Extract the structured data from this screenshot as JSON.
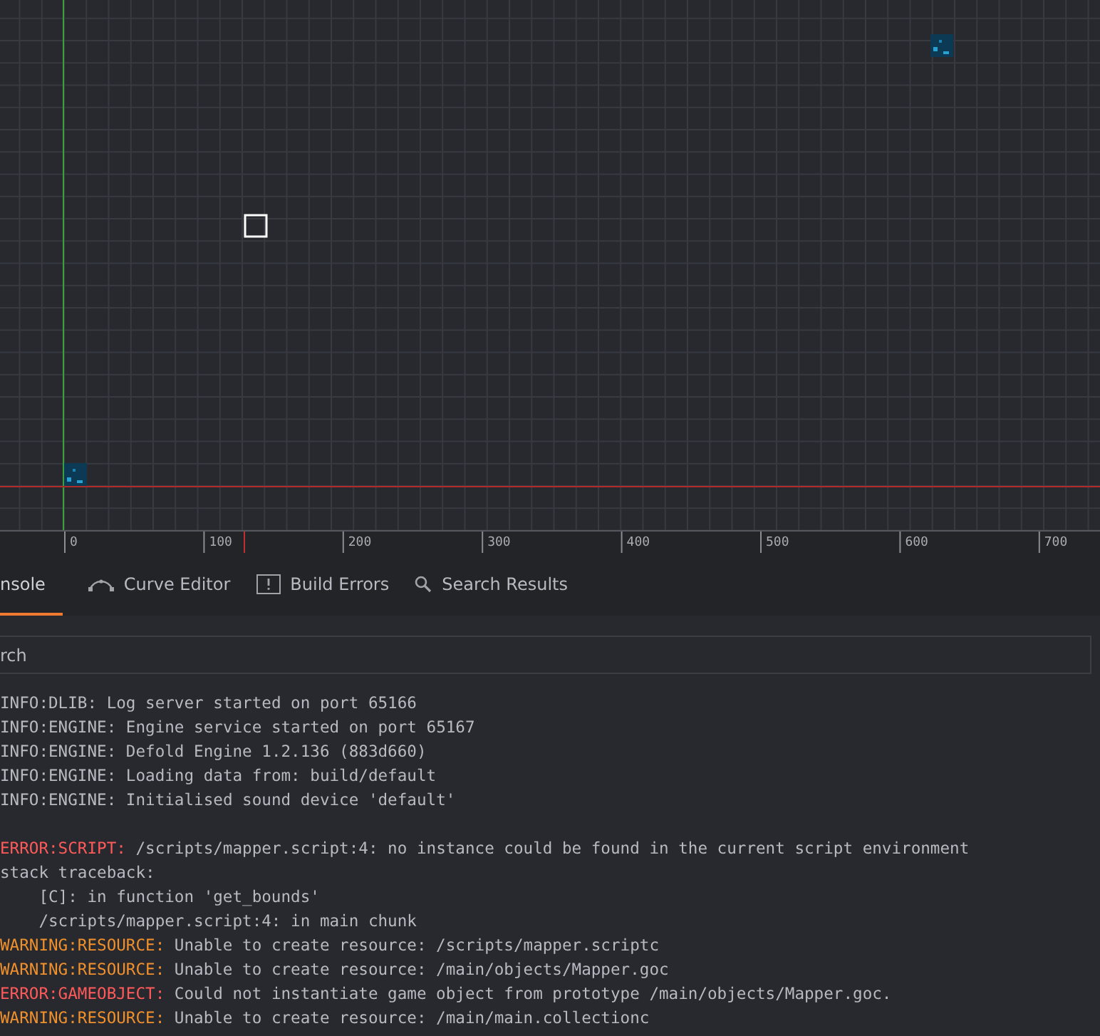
{
  "viewport": {
    "ruler": {
      "labels": [
        "0",
        "100",
        "200",
        "300",
        "400",
        "500",
        "600",
        "700"
      ]
    }
  },
  "tabs": [
    {
      "label": "nsole",
      "kind": "plain",
      "selected": true
    },
    {
      "label": "Curve Editor",
      "kind": "curve",
      "selected": false
    },
    {
      "label": "Build Errors",
      "kind": "errors",
      "selected": false
    },
    {
      "label": "Search Results",
      "kind": "search",
      "selected": false
    }
  ],
  "search": {
    "placeholder": "rch"
  },
  "console": [
    {
      "kind": "info",
      "prefix": "INFO:DLIB:",
      "text": " Log server started on port 65166"
    },
    {
      "kind": "info",
      "prefix": "INFO:ENGINE:",
      "text": " Engine service started on port 65167"
    },
    {
      "kind": "info",
      "prefix": "INFO:ENGINE:",
      "text": " Defold Engine 1.2.136 (883d660)"
    },
    {
      "kind": "info",
      "prefix": "INFO:ENGINE:",
      "text": " Loading data from: build/default"
    },
    {
      "kind": "info",
      "prefix": "INFO:ENGINE:",
      "text": " Initialised sound device 'default'"
    },
    {
      "kind": "blank"
    },
    {
      "kind": "error",
      "prefix": "ERROR:SCRIPT:",
      "text": " /scripts/mapper.script:4: no instance could be found in the current script environment"
    },
    {
      "kind": "plain",
      "text": "stack traceback:"
    },
    {
      "kind": "plain",
      "text": "    [C]: in function 'get_bounds'"
    },
    {
      "kind": "plain",
      "text": "    /scripts/mapper.script:4: in main chunk"
    },
    {
      "kind": "warning",
      "prefix": "WARNING:RESOURCE:",
      "text": " Unable to create resource: /scripts/mapper.scriptc"
    },
    {
      "kind": "warning",
      "prefix": "WARNING:RESOURCE:",
      "text": " Unable to create resource: /main/objects/Mapper.goc"
    },
    {
      "kind": "error",
      "prefix": "ERROR:GAMEOBJECT:",
      "text": " Could not instantiate game object from prototype /main/objects/Mapper.goc."
    },
    {
      "kind": "warning",
      "prefix": "WARNING:RESOURCE:",
      "text": " Unable to create resource: /main/main.collectionc"
    }
  ]
}
